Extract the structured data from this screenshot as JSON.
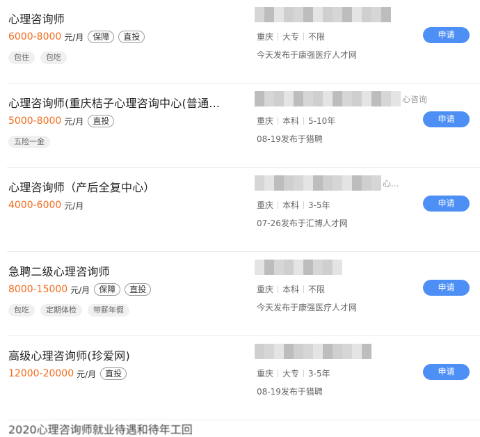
{
  "jobs": [
    {
      "title": "心理咨询师",
      "salary": "6000-8000",
      "unit": "元/月",
      "badges": [
        "保障",
        "直投"
      ],
      "tags": [
        "包住",
        "包吃"
      ],
      "company_tail": "",
      "meta": [
        "重庆",
        "大专",
        "不限"
      ],
      "source": "今天发布于康强医疗人才网",
      "apply_label": "申请"
    },
    {
      "title": "心理咨询师(重庆桔子心理咨询中心(普通...",
      "salary": "5000-8000",
      "unit": "元/月",
      "badges": [
        "直投"
      ],
      "tags": [
        "五险一金"
      ],
      "company_tail": "心咨询",
      "meta": [
        "重庆",
        "本科",
        "5-10年"
      ],
      "source": "08-19发布于猎聘",
      "apply_label": "申请"
    },
    {
      "title": "心理咨询师（产后全复中心）",
      "salary": "4000-6000",
      "unit": "元/月",
      "badges": [],
      "tags": [],
      "company_tail": "心...",
      "meta": [
        "重庆",
        "本科",
        "3-5年"
      ],
      "source": "07-26发布于汇博人才网",
      "apply_label": "申请"
    },
    {
      "title": "急聘二级心理咨询师",
      "salary": "8000-15000",
      "unit": "元/月",
      "badges": [
        "保障",
        "直投"
      ],
      "tags": [
        "包吃",
        "定期体检",
        "带薪年假"
      ],
      "company_tail": "",
      "meta": [
        "重庆",
        "本科",
        "不限"
      ],
      "source": "今天发布于康强医疗人才网",
      "apply_label": "申请"
    },
    {
      "title": "高级心理咨询师(珍爱网)",
      "salary": "12000-20000",
      "unit": "元/月",
      "badges": [
        "直投"
      ],
      "tags": [],
      "company_tail": "",
      "meta": [
        "重庆",
        "大专",
        "3-5年"
      ],
      "source": "08-19发布于猎聘",
      "apply_label": "申请"
    }
  ],
  "next_item_peek": "2020心理咨询师就业待遇和待年工回"
}
